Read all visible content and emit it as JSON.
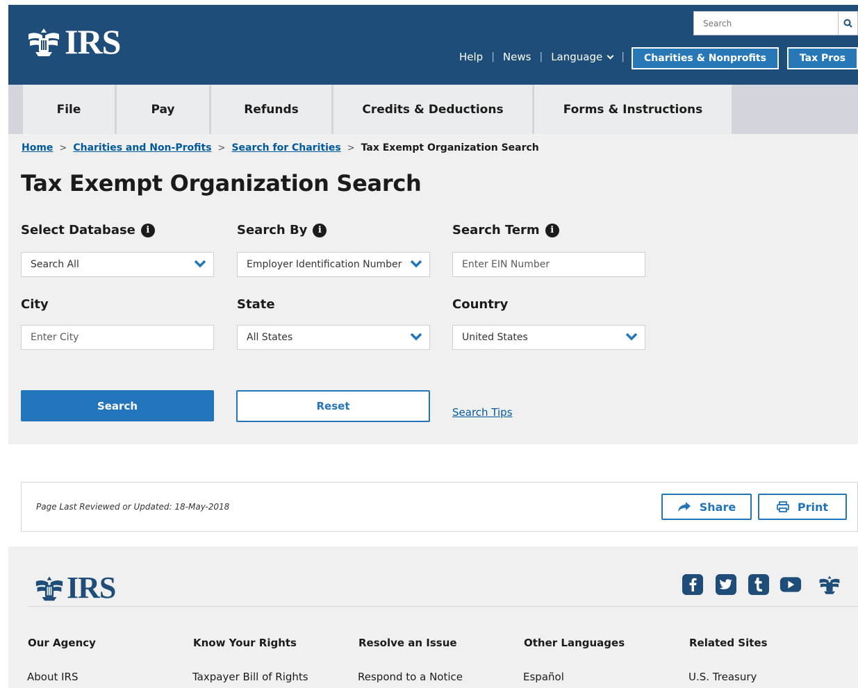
{
  "header": {
    "logo_text": "IRS",
    "search_placeholder": "Search",
    "util_links": [
      "Help",
      "News",
      "Language"
    ],
    "audience_buttons": [
      "Charities & Nonprofits",
      "Tax Pros"
    ]
  },
  "nav": {
    "items": [
      "File",
      "Pay",
      "Refunds",
      "Credits & Deductions",
      "Forms & Instructions"
    ]
  },
  "breadcrumb": {
    "items": [
      "Home",
      "Charities and Non-Profits",
      "Search for Charities"
    ],
    "current": "Tax Exempt Organization Search"
  },
  "page_title": "Tax Exempt Organization Search",
  "form": {
    "select_database_label": "Select Database",
    "select_database_value": "Search All",
    "search_by_label": "Search By",
    "search_by_value": "Employer Identification Number",
    "search_term_label": "Search Term",
    "search_term_placeholder": "Enter EIN Number",
    "city_label": "City",
    "city_placeholder": "Enter City",
    "state_label": "State",
    "state_value": "All States",
    "country_label": "Country",
    "country_value": "United States",
    "search_button": "Search",
    "reset_button": "Reset",
    "search_tips": "Search Tips"
  },
  "review": {
    "text": "Page Last Reviewed or Updated: 18-May-2018",
    "share": "Share",
    "print": "Print"
  },
  "footer": {
    "logo_text": "IRS",
    "columns": [
      {
        "heading": "Our Agency",
        "link": "About IRS"
      },
      {
        "heading": "Know Your Rights",
        "link": "Taxpayer Bill of Rights"
      },
      {
        "heading": "Resolve an Issue",
        "link": "Respond to a Notice"
      },
      {
        "heading": "Other Languages",
        "link": "Español"
      },
      {
        "heading": "Related Sites",
        "link": "U.S. Treasury"
      }
    ],
    "social_icons": [
      "facebook-icon",
      "twitter-icon",
      "tumblr-icon",
      "youtube-icon",
      "irs-eagle-icon"
    ]
  },
  "colors": {
    "header_bg": "#1d4d78",
    "accent_blue": "#2275bb",
    "link_blue": "#00599c",
    "content_bg": "#f0f0f0"
  }
}
